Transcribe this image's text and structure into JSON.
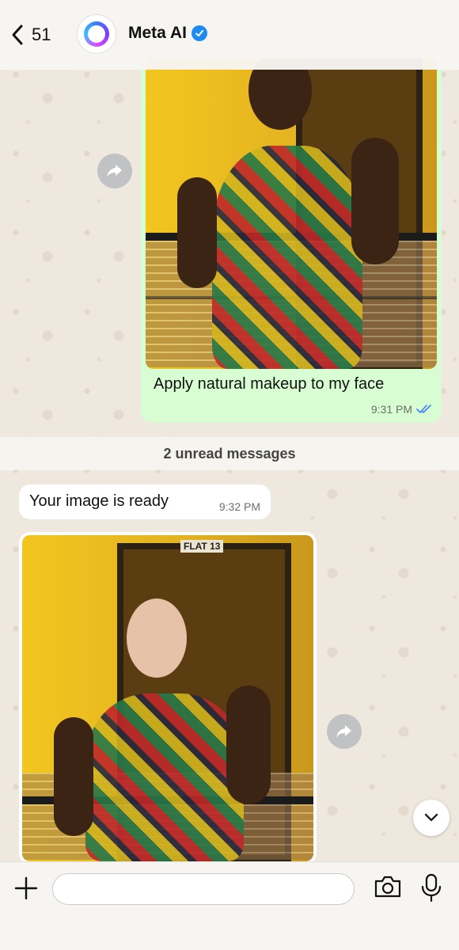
{
  "header": {
    "back_count": "51",
    "contact_name": "Meta AI",
    "avatar_icon": "meta-ai-ring-icon",
    "verified_icon": "verified-badge-icon",
    "verified_color": "#1d8bf1"
  },
  "messages": {
    "outgoing": {
      "caption": "Apply natural makeup to my face",
      "time": "9:31 PM",
      "status_icon": "double-check-read-icon",
      "bubble_color": "#d9fdd3"
    },
    "unread_separator": "2 unread messages",
    "incoming_text": {
      "text": "Your image is ready",
      "time": "9:32 PM"
    },
    "incoming_image": {
      "sign_text": "FLAT 13"
    }
  },
  "input_bar": {
    "placeholder": "",
    "plus_icon": "plus-icon",
    "camera_icon": "camera-icon",
    "mic_icon": "microphone-icon"
  },
  "colors": {
    "accent_check": "#3b82f6",
    "wallpaper": "#efe8de"
  }
}
